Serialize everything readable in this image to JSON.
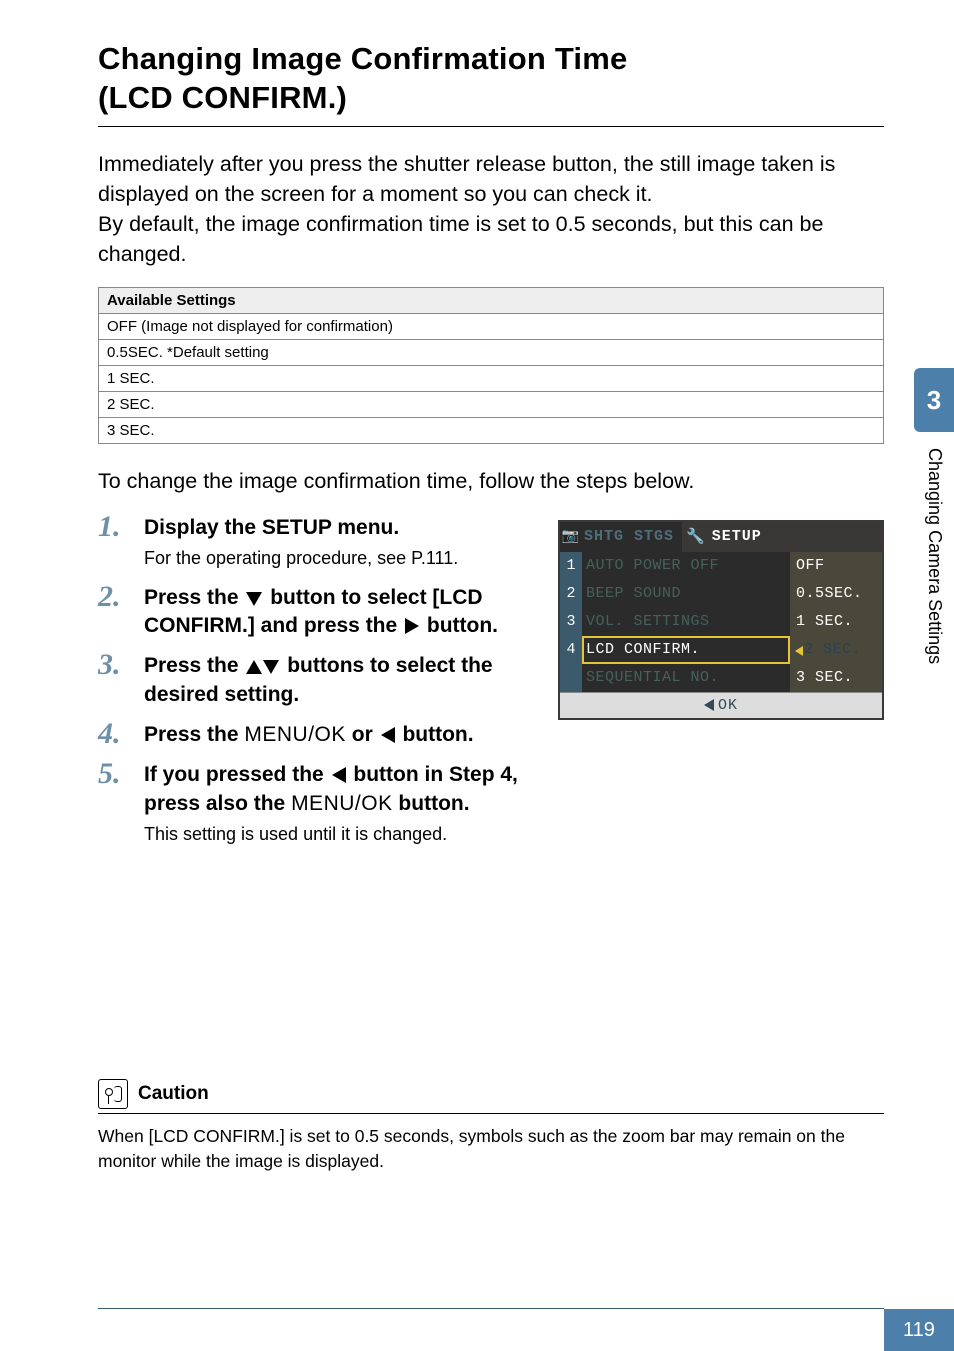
{
  "title_line1": "Changing Image Confirmation Time",
  "title_line2": "(LCD CONFIRM.)",
  "intro": "Immediately after you press the shutter release button, the still image taken is displayed on the screen for a moment so you can check it.\nBy default, the image confirmation time is set to 0.5 seconds, but this can be changed.",
  "settings": {
    "header": "Available Settings",
    "rows": [
      "OFF (Image not displayed for confirmation)",
      "0.5SEC. *Default setting",
      "1 SEC.",
      "2 SEC.",
      "3 SEC."
    ]
  },
  "lead": "To change the image confirmation time, follow the steps below.",
  "steps": {
    "s1": {
      "head": "Display the SETUP menu.",
      "sub": "For the operating procedure, see P.111."
    },
    "s2": {
      "pre": "Press the ",
      "post": " button to select [LCD CONFIRM.] and press the ",
      "post2": " button."
    },
    "s3": {
      "pre": "Press the ",
      "post": " buttons to select the desired setting."
    },
    "s4": {
      "pre": "Press the ",
      "menu": "MENU/OK",
      "mid": "  or ",
      "post": " button."
    },
    "s5": {
      "pre": "If you pressed the ",
      "mid": " button in Step 4, press also the ",
      "menu": "MENU/OK",
      "post": " button.",
      "sub": "This setting is used until it is changed."
    }
  },
  "lcd": {
    "tab_shtg": "SHTG STGS",
    "tab_setup": "SETUP",
    "rows": [
      {
        "n": "1",
        "key": "AUTO POWER OFF",
        "val": "OFF"
      },
      {
        "n": "2",
        "key": "BEEP SOUND",
        "val": "0.5SEC."
      },
      {
        "n": "3",
        "key": "VOL. SETTINGS",
        "val": "1 SEC."
      },
      {
        "n": "4",
        "key": "LCD CONFIRM.",
        "val": "2 SEC."
      },
      {
        "n": "",
        "key": "SEQUENTIAL NO.",
        "val": "3 SEC."
      }
    ],
    "footer": "OK"
  },
  "side": {
    "num": "3",
    "label": "Changing Camera Settings"
  },
  "caution": {
    "title": "Caution",
    "body": "When [LCD CONFIRM.] is set to 0.5 seconds, symbols such as the zoom bar may remain on the monitor while the image is displayed."
  },
  "page_number": "119"
}
